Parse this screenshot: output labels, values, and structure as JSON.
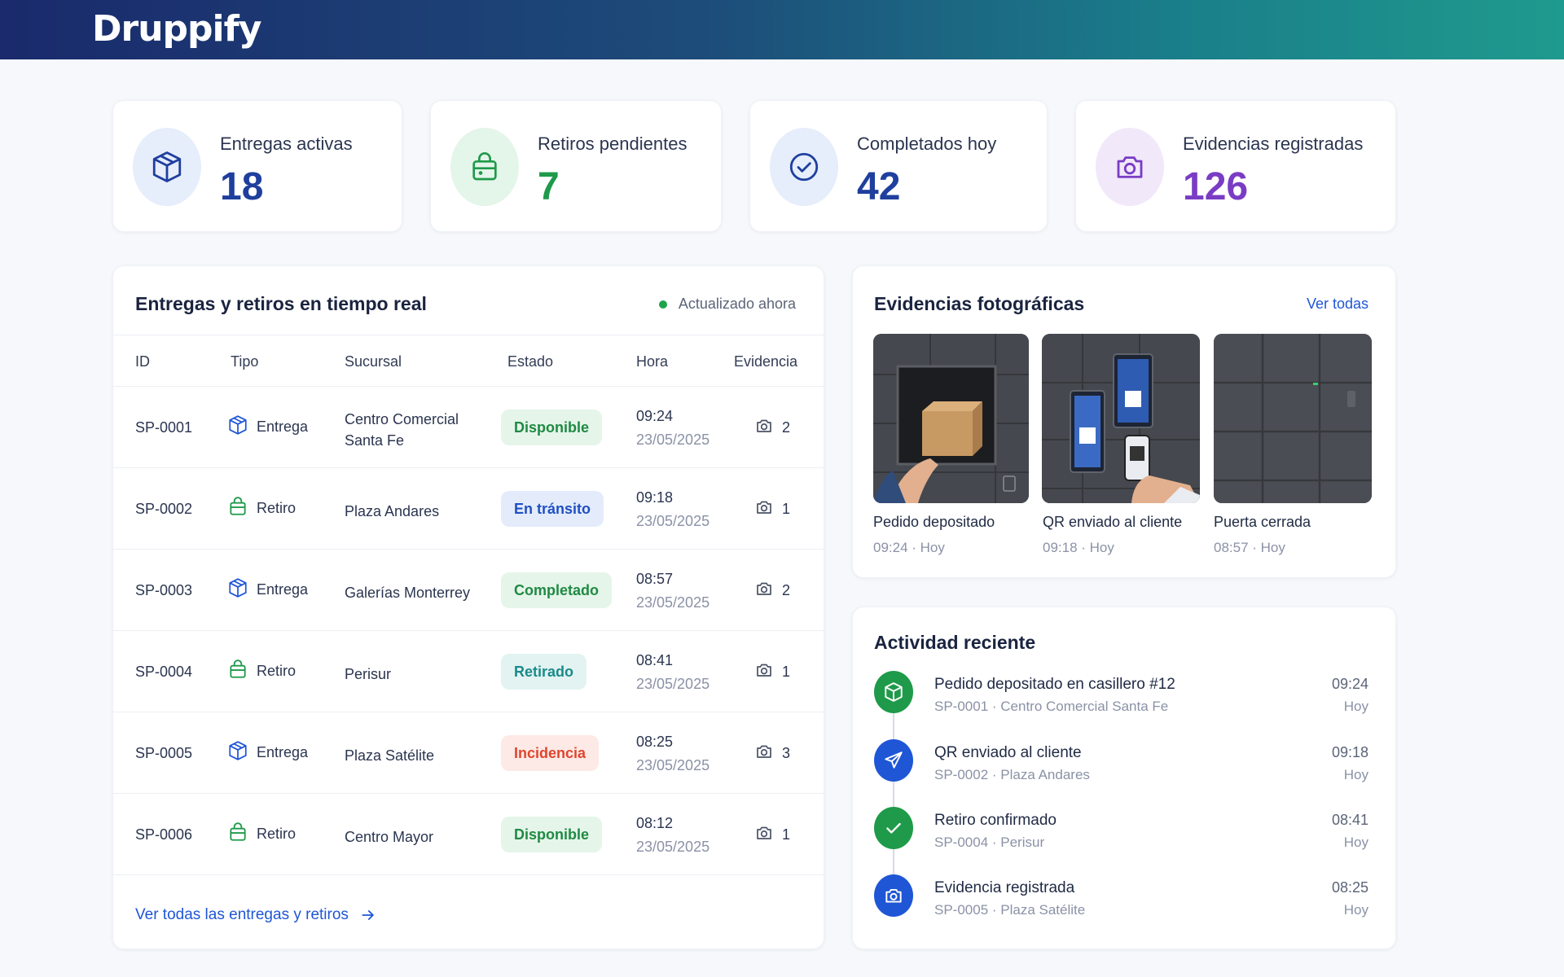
{
  "app": {
    "logo": "Druppify"
  },
  "stats": [
    {
      "label": "Entregas activas",
      "value": "18",
      "icon": "package-icon",
      "color": "#1f3f9e",
      "bg": "#e6edfb"
    },
    {
      "label": "Retiros pendientes",
      "value": "7",
      "icon": "shopping-bag-icon",
      "color": "#1f9a4a",
      "bg": "#e4f5ea"
    },
    {
      "label": "Completados hoy",
      "value": "42",
      "icon": "check-circle-icon",
      "color": "#1f3f9e",
      "bg": "#e6edfb"
    },
    {
      "label": "Evidencias registradas",
      "value": "126",
      "icon": "camera-icon",
      "color": "#7a3cc4",
      "bg": "#f1e8fa"
    }
  ],
  "table": {
    "title": "Entregas y retiros en tiempo real",
    "live": "Actualizado ahora",
    "columns": [
      "ID",
      "Tipo",
      "Sucursal",
      "Estado",
      "Hora",
      "Evidencia"
    ],
    "rows": [
      {
        "id": "SP-0001",
        "type": "Entrega",
        "branch": "Centro Comercial\nSanta Fe",
        "status": "Disponible",
        "time": "09:24",
        "date": "23/05/2025",
        "evidence": "2"
      },
      {
        "id": "SP-0002",
        "type": "Retiro",
        "branch": "Plaza Andares",
        "status": "En tránsito",
        "time": "09:18",
        "date": "23/05/2025",
        "evidence": "1"
      },
      {
        "id": "SP-0003",
        "type": "Entrega",
        "branch": "Galerías Monterrey",
        "status": "Completado",
        "time": "08:57",
        "date": "23/05/2025",
        "evidence": "2"
      },
      {
        "id": "SP-0004",
        "type": "Retiro",
        "branch": "Perisur",
        "status": "Retirado",
        "time": "08:41",
        "date": "23/05/2025",
        "evidence": "1"
      },
      {
        "id": "SP-0005",
        "type": "Entrega",
        "branch": "Plaza Satélite",
        "status": "Incidencia",
        "time": "08:25",
        "date": "23/05/2025",
        "evidence": "3"
      },
      {
        "id": "SP-0006",
        "type": "Retiro",
        "branch": "Centro Mayor",
        "status": "Disponible",
        "time": "08:12",
        "date": "23/05/2025",
        "evidence": "1"
      }
    ],
    "footer_link": "Ver todas las entregas y retiros"
  },
  "status_colors": {
    "Disponible": {
      "fg": "#1f8a42",
      "bg": "#e5f5ea"
    },
    "En tránsito": {
      "fg": "#1f4fc4",
      "bg": "#e4ecfb"
    },
    "Completado": {
      "fg": "#1f8a42",
      "bg": "#e5f5ea"
    },
    "Retirado": {
      "fg": "#1a8a8a",
      "bg": "#e2f3f2"
    },
    "Incidencia": {
      "fg": "#e0452f",
      "bg": "#fde9e5"
    }
  },
  "photos": {
    "title": "Evidencias fotográficas",
    "view_all": "Ver todas",
    "items": [
      {
        "caption": "Pedido depositado",
        "sub": "09:24 · Hoy"
      },
      {
        "caption": "QR enviado al cliente",
        "sub": "09:18 · Hoy"
      },
      {
        "caption": "Puerta cerrada",
        "sub": "08:57 · Hoy"
      }
    ]
  },
  "activity": {
    "title": "Actividad reciente",
    "items": [
      {
        "title": "Pedido depositado en casillero #12",
        "sub": "SP-0001 · Centro Comercial Santa Fe",
        "time": "09:24",
        "day": "Hoy",
        "icon": "package-icon",
        "color": "#1f9a4a"
      },
      {
        "title": "QR enviado al cliente",
        "sub": "SP-0002 · Plaza Andares",
        "time": "09:18",
        "day": "Hoy",
        "icon": "send-icon",
        "color": "#1f56d6"
      },
      {
        "title": "Retiro confirmado",
        "sub": "SP-0004 · Perisur",
        "time": "08:41",
        "day": "Hoy",
        "icon": "check-icon",
        "color": "#1f9a4a"
      },
      {
        "title": "Evidencia registrada",
        "sub": "SP-0005 · Plaza Satélite",
        "time": "08:25",
        "day": "Hoy",
        "icon": "camera-icon",
        "color": "#1f56d6"
      }
    ]
  }
}
